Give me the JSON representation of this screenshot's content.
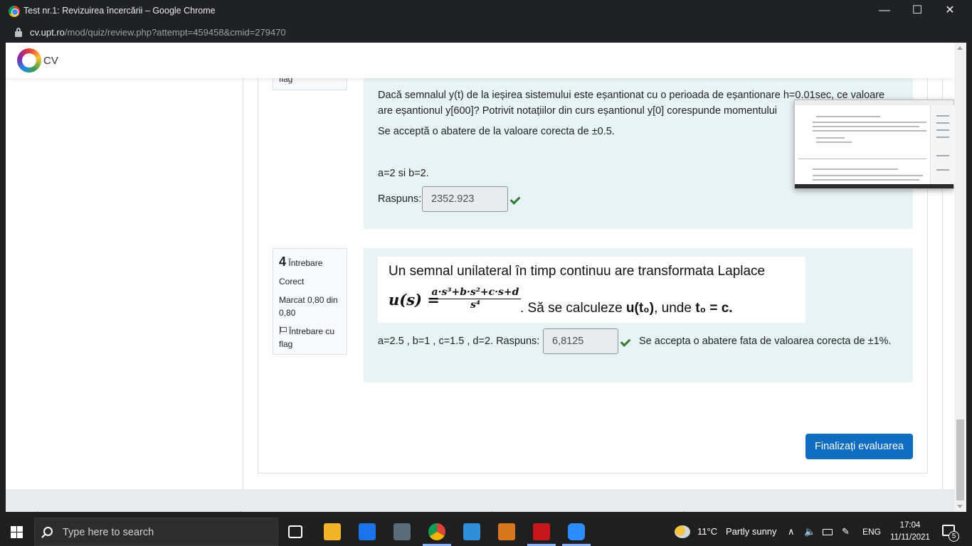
{
  "window": {
    "title": "Test nr.1: Revizuirea încercării – Google Chrome",
    "url_host": "cv.upt.ro",
    "url_path": "/mod/quiz/review.php?attempt=459458&cmid=279470"
  },
  "site": {
    "logo_text": "CV"
  },
  "question3": {
    "info_partial": "flag",
    "text_line1": "Dacă semnalul y(t) de la ieșirea sistemului este eșantionat cu o perioada de eșantionare h=0.01sec, ce valoare",
    "text_line2": "are eșantionul y[600]?  Potrivit notațiilor din curs eșantionul y[0] corespunde momentului",
    "tolerance": "Se acceptă o abatere de la valoare corecta de ±0.5.",
    "params": "a=2 si b=2.",
    "answer_label": "Raspuns:",
    "answer_value": "2352.923"
  },
  "question4": {
    "number": "4",
    "word": "Întrebare",
    "status": "Corect",
    "mark": "Marcat 0,80 din 0,80",
    "flag_label": "Întrebare cu flag",
    "heading": "Un semnal unilateral în timp continuu are transformata Laplace",
    "formula_lhs": "u(s) =",
    "formula_num": "a·s³+b·s²+c·s+d",
    "formula_den": "s⁴",
    "formula_tail_a": ". Să se calculeze ",
    "formula_tail_b": "u(t₀)",
    "formula_tail_c": ", unde ",
    "formula_tail_d": "t₀ = c.",
    "params": "a=2.5 , b=1 , c=1.5 , d=2. Raspuns:",
    "answer_value": "6,8125",
    "tolerance": "Se accepta o abatere fata de valoarea corecta de ±1%."
  },
  "finish_button": "Finalizați evaluarea",
  "taskbar": {
    "search_placeholder": "Type here to search",
    "weather_temp": "11°C",
    "weather_text": "Partly sunny",
    "language": "ENG",
    "time": "17:04",
    "date": "11/11/2021",
    "notification_count": "5"
  }
}
